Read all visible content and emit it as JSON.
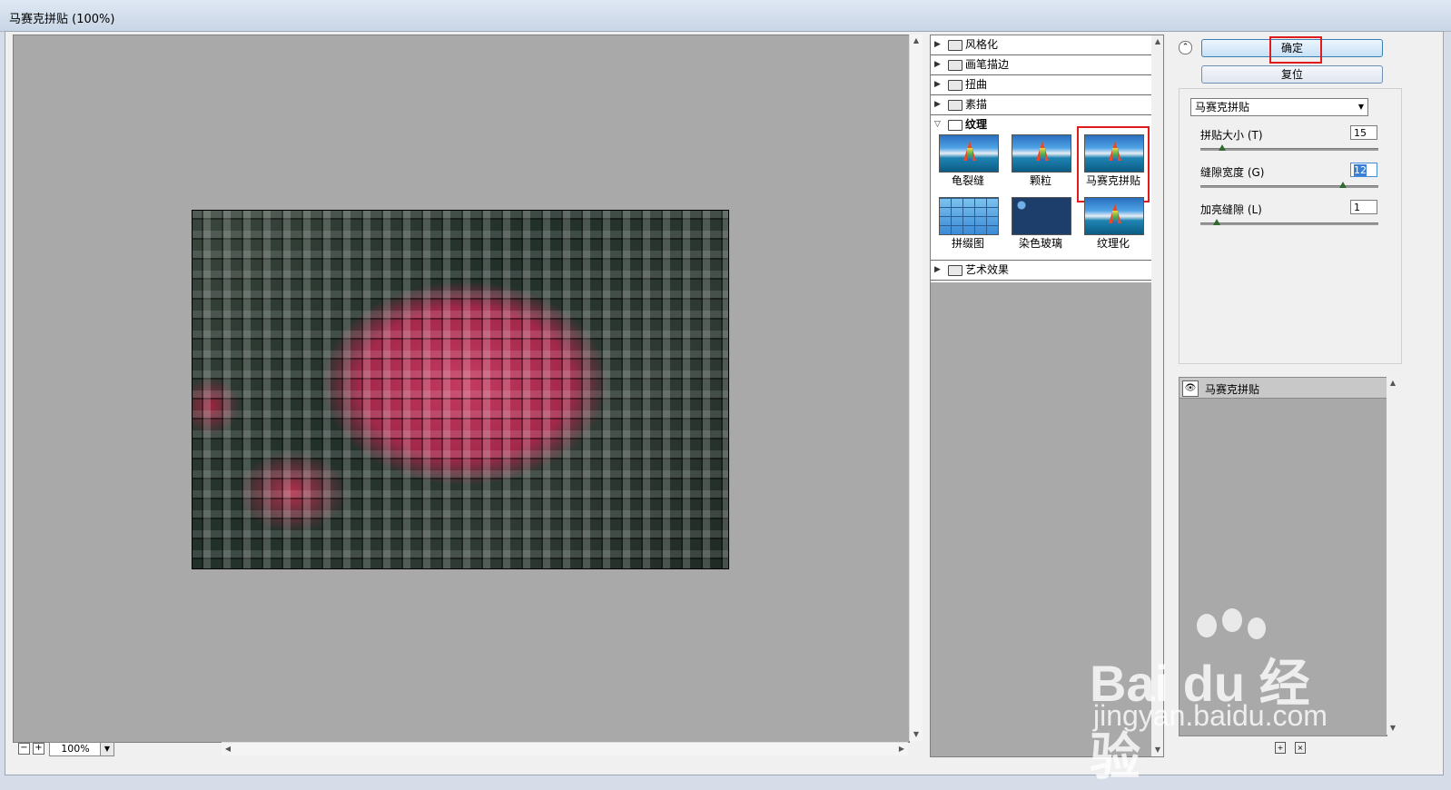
{
  "window": {
    "title": "马赛克拼贴 (100%)"
  },
  "preview": {
    "zoom": "100%"
  },
  "gallery": {
    "categories": [
      {
        "label": "风格化",
        "expanded": false
      },
      {
        "label": "画笔描边",
        "expanded": false
      },
      {
        "label": "扭曲",
        "expanded": false
      },
      {
        "label": "素描",
        "expanded": false
      },
      {
        "label": "纹理",
        "expanded": true
      },
      {
        "label": "艺术效果",
        "expanded": false
      }
    ],
    "texture_filters": [
      {
        "label": "龟裂缝"
      },
      {
        "label": "颗粒"
      },
      {
        "label": "马赛克拼贴",
        "selected": true
      },
      {
        "label": "拼缀图"
      },
      {
        "label": "染色玻璃"
      },
      {
        "label": "纹理化"
      }
    ]
  },
  "buttons": {
    "ok": "确定",
    "reset": "复位"
  },
  "filter_select": {
    "value": "马赛克拼贴"
  },
  "params": [
    {
      "label": "拼贴大小 (T)",
      "value": "15",
      "level": 0.12
    },
    {
      "label": "缝隙宽度 (G)",
      "value": "12",
      "level": 0.8
    },
    {
      "label": "加亮缝隙 (L)",
      "value": "1",
      "level": 0.09
    }
  ],
  "layers": {
    "items": [
      {
        "label": "马赛克拼贴"
      }
    ]
  },
  "watermark": {
    "brand": "Bai du 经验",
    "url": "jingyan.baidu.com"
  },
  "colors": {
    "highlight": "#e01b1b",
    "canvas_bg": "#a9a9a9"
  }
}
